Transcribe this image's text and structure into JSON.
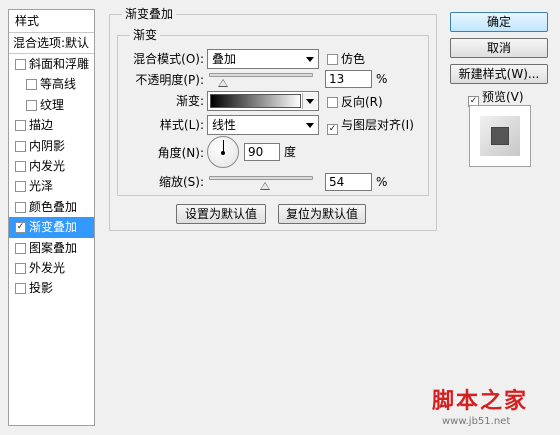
{
  "styles_panel": {
    "header": "样式",
    "blend_options": "混合选项:默认",
    "items": [
      {
        "label": "斜面和浮雕",
        "checked": false,
        "indent": false,
        "selected": false
      },
      {
        "label": "等高线",
        "checked": false,
        "indent": true,
        "selected": false
      },
      {
        "label": "纹理",
        "checked": false,
        "indent": true,
        "selected": false
      },
      {
        "label": "描边",
        "checked": false,
        "indent": false,
        "selected": false
      },
      {
        "label": "内阴影",
        "checked": false,
        "indent": false,
        "selected": false
      },
      {
        "label": "内发光",
        "checked": false,
        "indent": false,
        "selected": false
      },
      {
        "label": "光泽",
        "checked": false,
        "indent": false,
        "selected": false
      },
      {
        "label": "颜色叠加",
        "checked": false,
        "indent": false,
        "selected": false
      },
      {
        "label": "渐变叠加",
        "checked": true,
        "indent": false,
        "selected": true
      },
      {
        "label": "图案叠加",
        "checked": false,
        "indent": false,
        "selected": false
      },
      {
        "label": "外发光",
        "checked": false,
        "indent": false,
        "selected": false
      },
      {
        "label": "投影",
        "checked": false,
        "indent": false,
        "selected": false
      }
    ]
  },
  "gradient_overlay": {
    "outer_title": "渐变叠加",
    "inner_title": "渐变",
    "blend_mode_label": "混合模式(O):",
    "blend_mode_value": "叠加",
    "dither_label": "仿色",
    "dither_checked": false,
    "opacity_label": "不透明度(P):",
    "opacity_value": "13",
    "opacity_fraction": 0.13,
    "opacity_unit": "%",
    "gradient_label": "渐变:",
    "reverse_label": "反向(R)",
    "reverse_checked": false,
    "style_label": "样式(L):",
    "style_value": "线性",
    "align_label": "与图层对齐(I)",
    "align_checked": true,
    "angle_label": "角度(N):",
    "angle_value": "90",
    "angle_unit": "度",
    "scale_label": "缩放(S):",
    "scale_value": "54",
    "scale_fraction": 0.54,
    "scale_unit": "%",
    "make_default_button": "设置为默认值",
    "reset_default_button": "复位为默认值"
  },
  "actions": {
    "ok_button": "确定",
    "cancel_button": "取消",
    "new_style_button": "新建样式(W)...",
    "preview_label": "预览(V)",
    "preview_checked": true
  },
  "watermark": {
    "main_text": "脚本之家",
    "sub_text": "www.jb51.net"
  }
}
